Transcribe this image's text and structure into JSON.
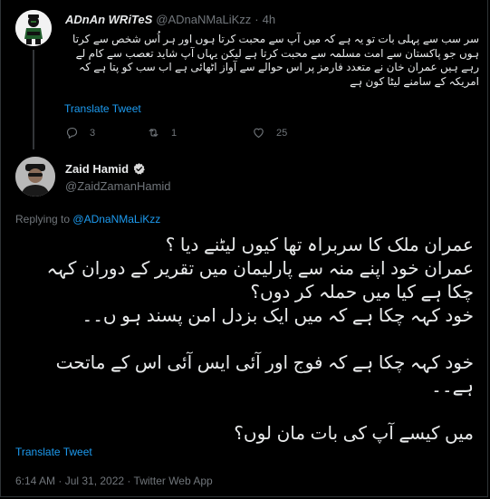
{
  "parent_tweet": {
    "display_name": "ADnAn WRiTeS",
    "handle": "@ADnaNMaLiKzz",
    "separator": "·",
    "time": "4h",
    "text": "سر سب سے پہلی بات تو یہ ہے کہ میں آپ سے محبت کرتا ہوں اور ہر اُس شخص سے کرتا ہوں جو پاکستان سے امت مسلمہ سے محبت کرتا ہے لیکن یہاں آپ شاید تعصب سے کام لے رہے ہیں عمران خان نے متعدد فارمز پر اس حوالے سے آواز اٹھائی ہے اب سب کو پتا ہے کہ امریکہ کے سامنے لیٹا کون ہے",
    "translate_label": "Translate Tweet",
    "actions": {
      "reply_count": "3",
      "retweet_count": "1",
      "like_count": "25"
    },
    "avatar_icon": "cartoon-avatar-icon"
  },
  "main_tweet": {
    "display_name": "Zaid Hamid",
    "handle": "@ZaidZamanHamid",
    "verified_icon": "verified-badge-icon",
    "replying_prefix": "Replying to",
    "replying_to": "@ADnaNMaLiKzz",
    "paragraphs": [
      [
        "عمران ملک کا سربراہ تھا کیوں لیٹنے دیا ؟",
        "عمران خود اپنے منہ سے پارلیمان میں تقریر کے دوران کہہ چکا ہے کیا میں حملہ کر دوں؟",
        "خود کہہ چکا ہے کہ میں ایک بزدل امن پسند ہو ں۔۔"
      ],
      [
        "خود کہہ چکا ہے کہ فوج اور آئی ایس آئی اس کے ماتحت ہے۔۔"
      ],
      [
        "میں کیسے آپ کی بات مان لوں؟"
      ]
    ],
    "translate_label": "Translate Tweet",
    "meta": "6:14 AM · Jul 31, 2022 · Twitter Web App"
  },
  "colors": {
    "background": "#000000",
    "text": "#e7e9ea",
    "muted": "#71767b",
    "link": "#1d9bf0",
    "verified": "#1d9bf0",
    "divider": "#2f3336"
  }
}
